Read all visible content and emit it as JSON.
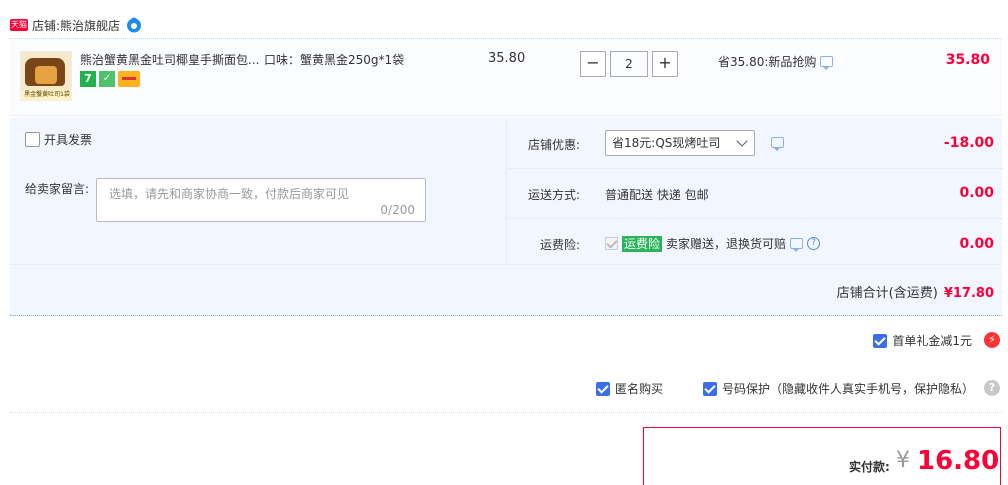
{
  "shop": {
    "badge": "天猫",
    "label": "店铺:",
    "name": "熊治旗舰店"
  },
  "item": {
    "thumb_caption": "黑金蟹黄吐司1袋",
    "title": "熊治蟹黄黑金吐司椰皇手撕面包...",
    "attr": "口味：蟹黄黑金250g*1袋",
    "badge_seven": "7",
    "unit_price": "35.80",
    "qty_minus": "−",
    "qty": "2",
    "qty_plus": "+",
    "promo": "省35.80:新品抢购",
    "line_total": "35.80"
  },
  "options": {
    "invoice_label": "开具发票",
    "message_label": "给卖家留言:",
    "message_placeholder": "选填，请先和商家协商一致，付款后商家可见",
    "message_count": "0/200",
    "coupon_label": "店铺优惠:",
    "coupon_value": "省18元:QS现烤吐司",
    "coupon_amount": "-18.00",
    "shipping_label": "运送方式:",
    "shipping_value": "普通配送 快递 包邮",
    "shipping_amount": "0.00",
    "insurance_label": "运费险:",
    "insurance_tag": "运费险",
    "insurance_text": "卖家赠送，退换货可赔",
    "insurance_amount": "0.00",
    "shop_total_label": "店铺合计(含运费)",
    "shop_total_value": "¥17.80"
  },
  "bottom": {
    "gift_label": "首单礼金减1元",
    "bolt": "⚡",
    "anon_label": "匿名购买",
    "protect_label": "号码保护（隐藏收件人真实手机号，保护隐私）",
    "help": "?",
    "pay_label": "实付款:",
    "pay_currency": "¥",
    "pay_amount": "16.80"
  },
  "colors": {
    "accent_red": "#ff0036",
    "panel_bg": "#f2f7ff",
    "checkbox_blue": "#3b6ee8"
  }
}
